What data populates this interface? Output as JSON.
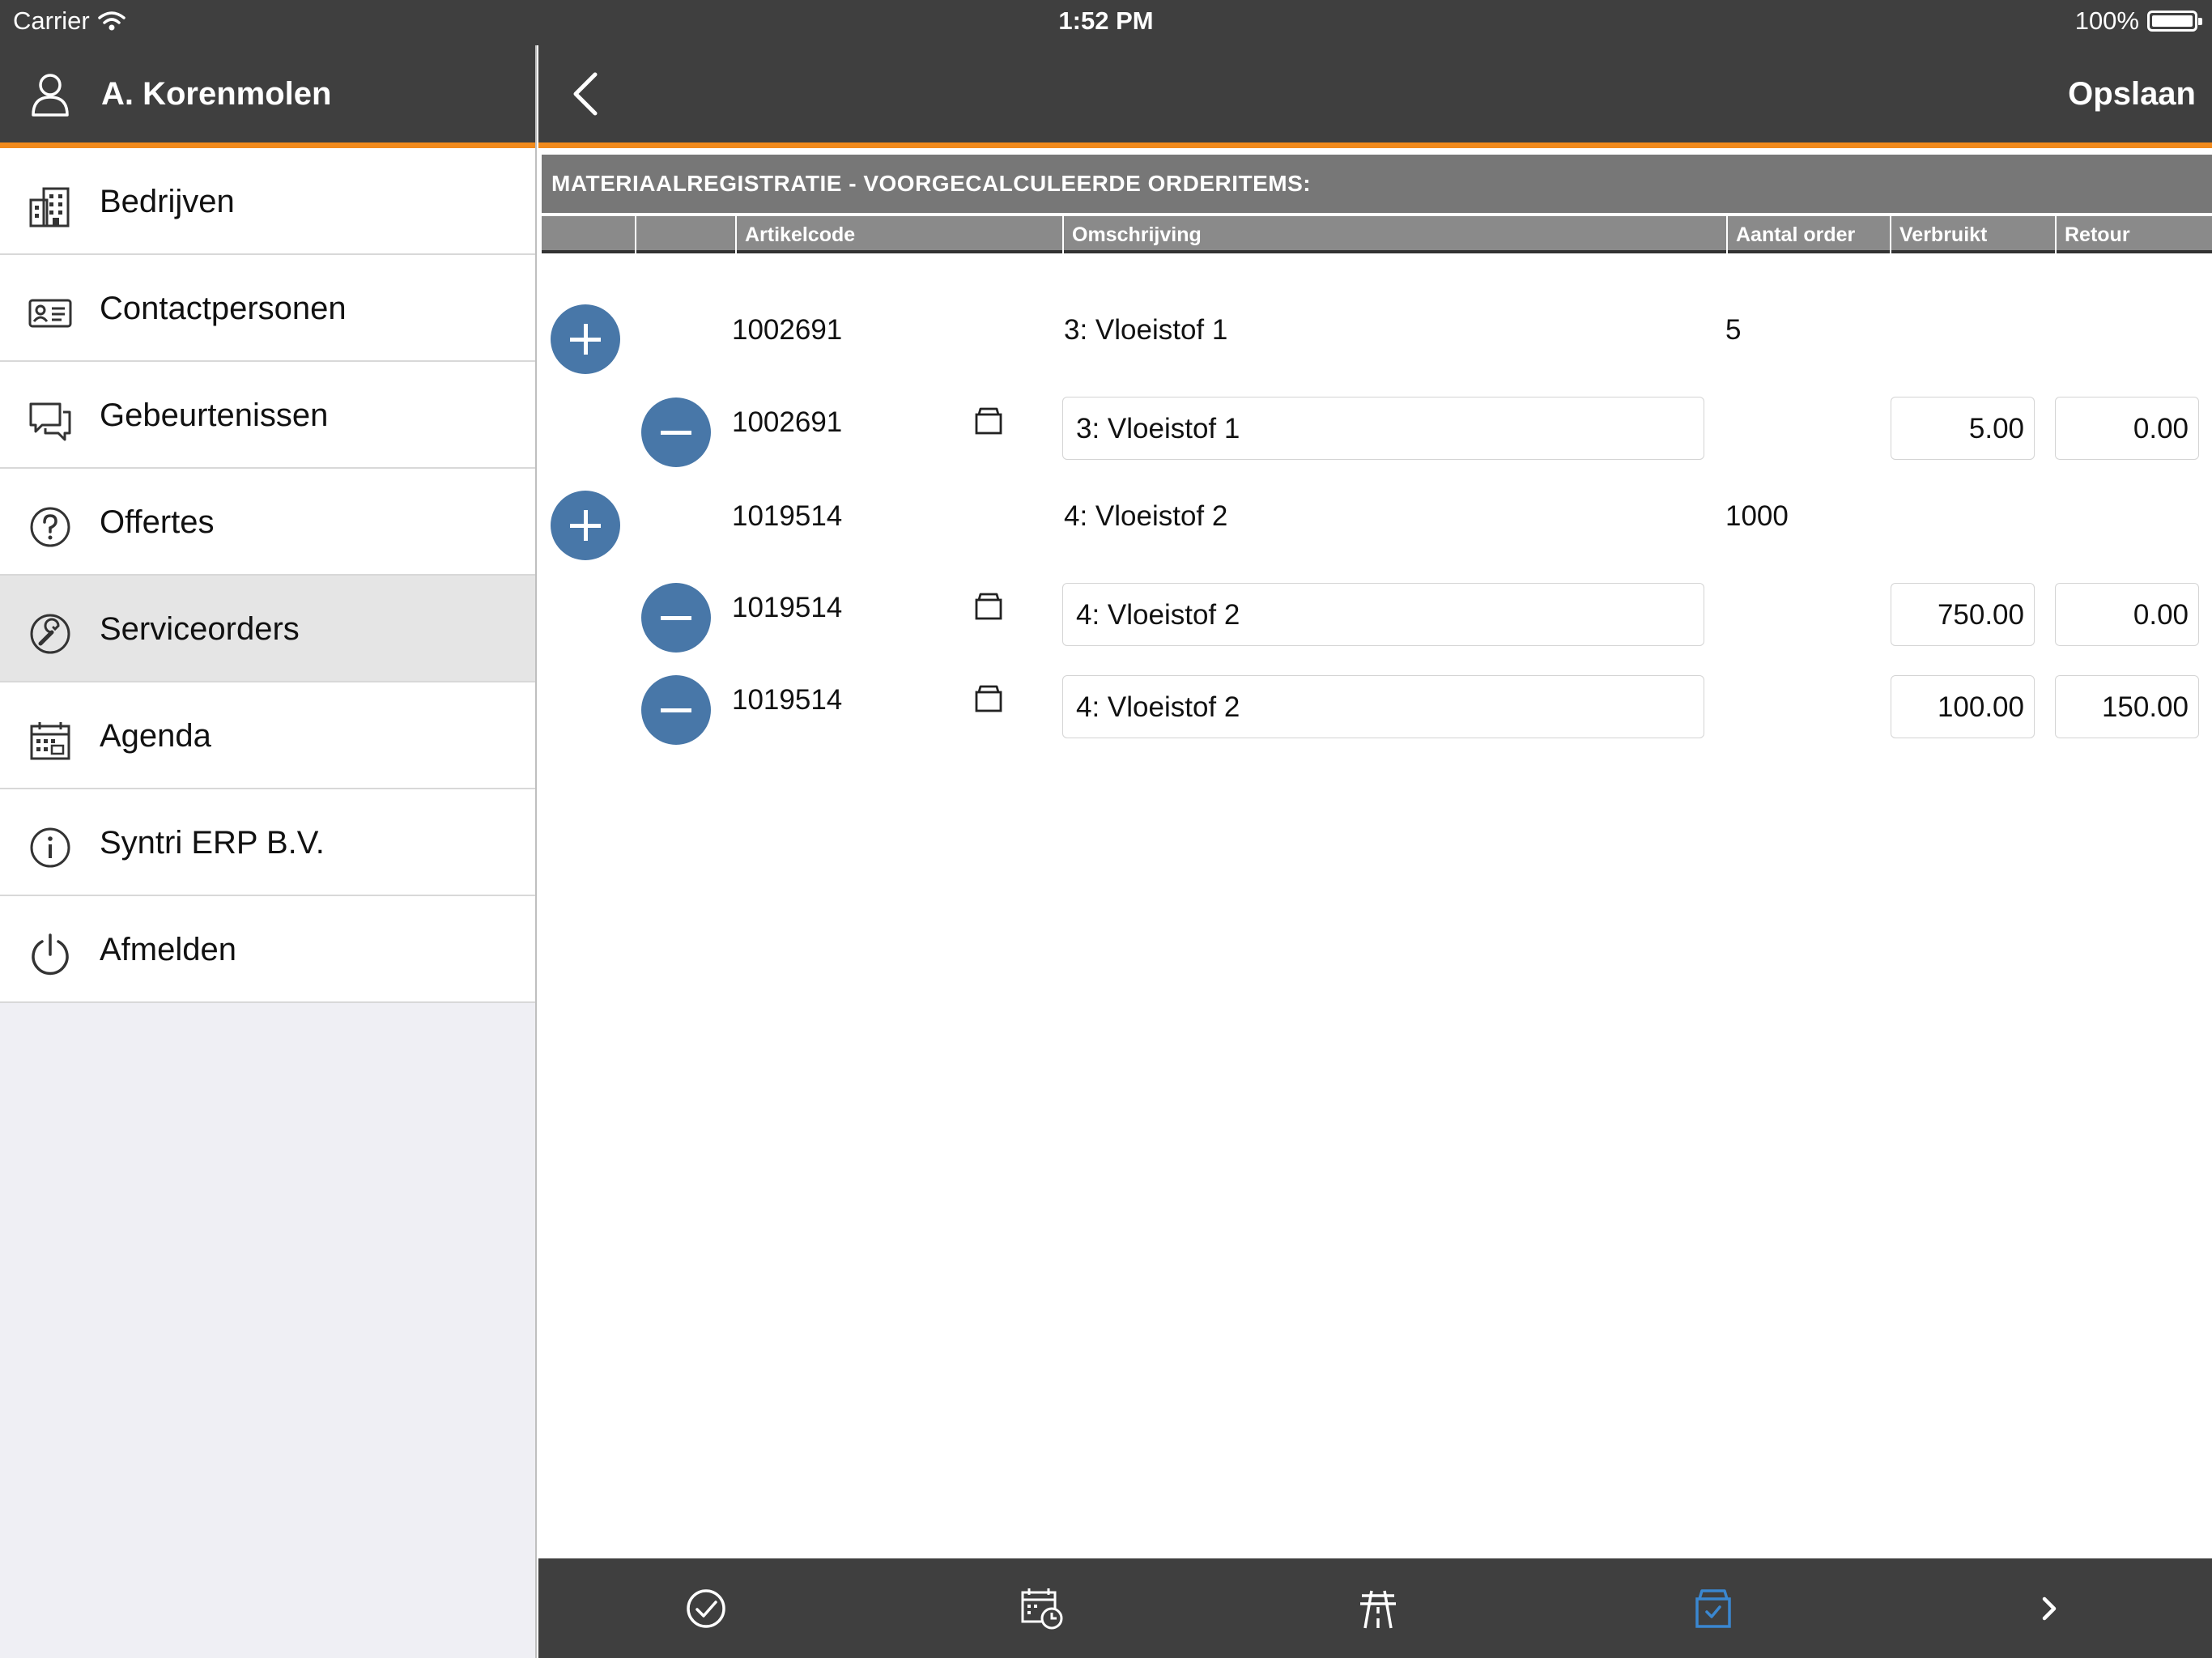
{
  "status_bar": {
    "carrier": "Carrier",
    "time": "1:52 PM",
    "battery": "100%"
  },
  "user": {
    "name": "A. Korenmolen"
  },
  "menu": [
    {
      "label": "Bedrijven",
      "icon": "buildings-icon"
    },
    {
      "label": "Contactpersonen",
      "icon": "contact-card-icon"
    },
    {
      "label": "Gebeurtenissen",
      "icon": "chat-bubbles-icon"
    },
    {
      "label": "Offertes",
      "icon": "question-circle-icon"
    },
    {
      "label": "Serviceorders",
      "icon": "wrench-circle-icon",
      "active": true
    },
    {
      "label": "Agenda",
      "icon": "calendar-icon"
    },
    {
      "label": "Syntri ERP B.V.",
      "icon": "info-circle-icon"
    },
    {
      "label": "Afmelden",
      "icon": "power-icon"
    }
  ],
  "navbar": {
    "save_label": "Opslaan"
  },
  "section": {
    "title": "MATERIAALREGISTRATIE - VOORGECALCULEERDE ORDERITEMS:"
  },
  "columns": {
    "artikelcode": "Artikelcode",
    "omschrijving": "Omschrijving",
    "aantal_order": "Aantal order",
    "verbruikt": "Verbruikt",
    "retour": "Retour"
  },
  "rows": [
    {
      "type": "parent",
      "code": "1002691",
      "description": "3: Vloeistof 1",
      "qty": "5"
    },
    {
      "type": "child",
      "code": "1002691",
      "description": "3: Vloeistof 1",
      "used": "5.00",
      "returned": "0.00"
    },
    {
      "type": "parent",
      "code": "1019514",
      "description": "4: Vloeistof 2",
      "qty": "1000"
    },
    {
      "type": "child",
      "code": "1019514",
      "description": "4: Vloeistof 2",
      "used": "750.00",
      "returned": "0.00"
    },
    {
      "type": "child",
      "code": "1019514",
      "description": "4: Vloeistof 2",
      "used": "100.00",
      "returned": "150.00"
    }
  ],
  "toolbar": {
    "items": [
      "check-circle-icon",
      "calendar-clock-icon",
      "road-icon",
      "box-check-icon",
      "chevron-right-icon"
    ],
    "active": "box-check-icon",
    "active_color": "#3a87d0"
  },
  "colors": {
    "accent": "#f18a1c",
    "bar": "#3f3f3f",
    "button": "#4877a8"
  }
}
